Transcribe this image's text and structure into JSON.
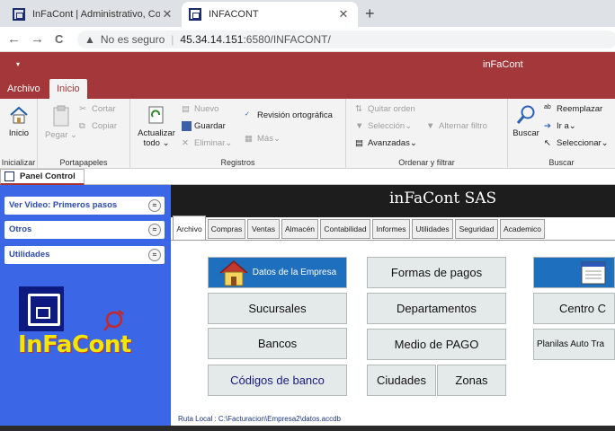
{
  "browser": {
    "tabs": [
      {
        "title": "InFaCont | Administrativo, Contal",
        "active": false
      },
      {
        "title": "INFACONT",
        "active": true
      }
    ],
    "close_glyph": "✕",
    "new_tab_glyph": "+",
    "nav_glyphs": {
      "back": "←",
      "forward": "→",
      "reload": "C"
    },
    "security_label": "No es seguro",
    "url_host": "45.34.14.151",
    "url_rest": ":6580/INFACONT/"
  },
  "app": {
    "qat_glyph": "▾",
    "title": "inFaCont",
    "ribbon_tabs": [
      {
        "label": "Archivo",
        "active": false
      },
      {
        "label": "Inicio",
        "active": true
      }
    ],
    "groups": {
      "views": {
        "label": "Inicializar",
        "home_label": "Inicio"
      },
      "clipboard": {
        "label": "Portapapeles",
        "paste": "Pegar",
        "cut": "Cortar",
        "copy": "Copiar"
      },
      "records": {
        "label": "Registros",
        "refresh": "Actualizar",
        "refresh2": "todo ⌄",
        "new": "Nuevo",
        "save": "Guardar",
        "delete": "Eliminar",
        "spell": "Revisión ortográfica",
        "more": "Más"
      },
      "sort": {
        "label": "Ordenar y filtrar",
        "remove_sort": "Quitar orden",
        "selection": "Selección",
        "toggle_filter": "Alternar filtro",
        "advanced": "Avanzadas"
      },
      "find": {
        "label": "Buscar",
        "find": "Buscar",
        "replace": "Reemplazar",
        "goto": "Ir a",
        "select": "Seleccionar"
      }
    },
    "doc_tab": "Panel Control"
  },
  "nav_panel": {
    "items": [
      {
        "label": "Ver Video: Primeros pasos"
      },
      {
        "label": "Otros"
      },
      {
        "label": "Utilidades"
      }
    ],
    "collapse_glyph": "≈",
    "logo_text": "InFaCont"
  },
  "form": {
    "company": "inFaCont SAS",
    "tabs": [
      "Archivo",
      "Compras",
      "Ventas",
      "Almacén",
      "Contabilidad",
      "Informes",
      "Utilidades",
      "Seguridad",
      "Academico"
    ],
    "buttons": {
      "empresa": "Datos de la Empresa",
      "sucursales": "Sucursales",
      "bancos": "Bancos",
      "codigos": "Códigos de banco",
      "formas": "Formas de pagos",
      "departamentos": "Departamentos",
      "medio": "Medio de PAGO",
      "ciudades": "Ciudades",
      "zonas": "Zonas",
      "centro": "Centro C",
      "planillas": "Planilas Auto Tra"
    },
    "status": "Ruta Local : C:\\Facturacion\\Empresa2\\datos.accdb"
  },
  "colors": {
    "accent": "#a4373a",
    "panel": "#3b66e6",
    "button_blue": "#1f6fbf",
    "logo_yellow": "#f3e600"
  }
}
